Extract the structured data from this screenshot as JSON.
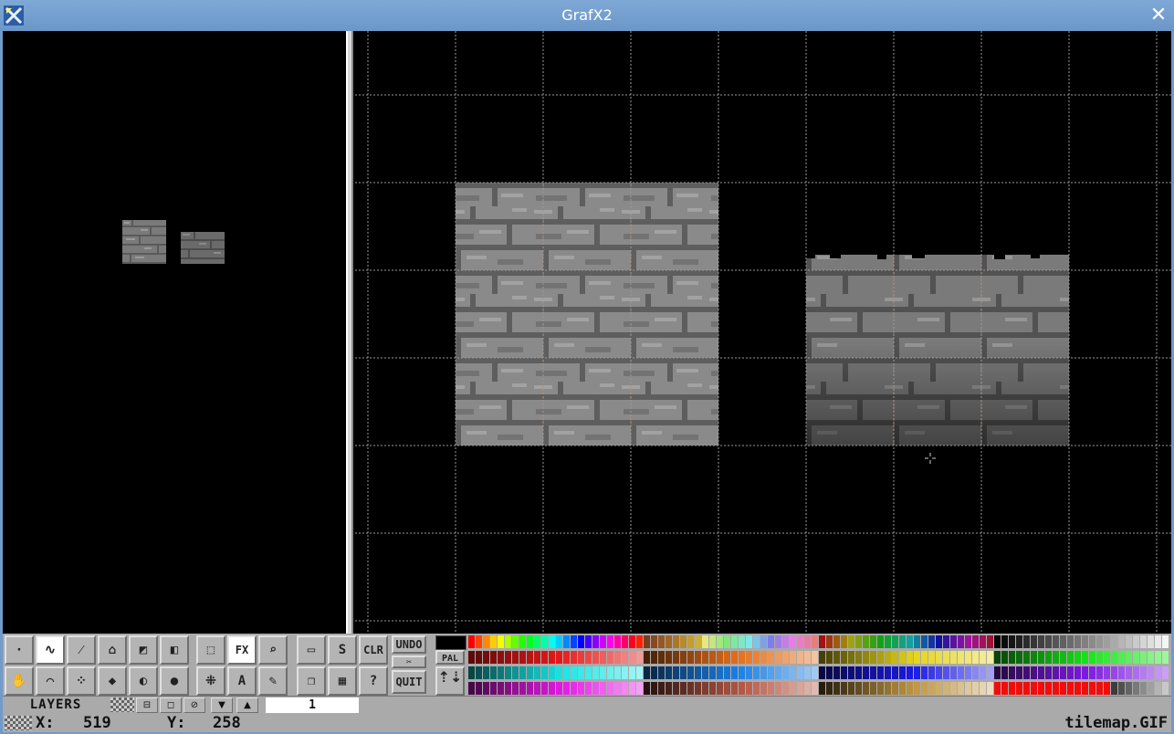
{
  "window": {
    "title": "GrafX2",
    "close_icon": "✕"
  },
  "preview": {
    "thumbnails": [
      "tile-stone-square",
      "tile-stone-top"
    ]
  },
  "toolbar": {
    "tools_row1": [
      {
        "name": "dot-brush-tool",
        "glyph": "·"
      },
      {
        "name": "freehand-tool",
        "glyph": "∿",
        "selected": true
      },
      {
        "name": "line-tool",
        "glyph": "⁄"
      },
      {
        "name": "fill-tool",
        "glyph": "⌂"
      },
      {
        "name": "gradient-rect-tool",
        "glyph": "◩"
      },
      {
        "name": "rect-tool",
        "glyph": "◧"
      }
    ],
    "tools_row2": [
      {
        "name": "pan-tool",
        "glyph": "✋"
      },
      {
        "name": "curve-tool",
        "glyph": "⌒"
      },
      {
        "name": "spray-tool",
        "glyph": "⁘"
      },
      {
        "name": "polyfill-tool",
        "glyph": "◆"
      },
      {
        "name": "ellipse-tool",
        "glyph": "◐"
      },
      {
        "name": "sphere-tool",
        "glyph": "●"
      }
    ],
    "group2_row1": [
      {
        "name": "brush-select-tool",
        "glyph": "⬚"
      },
      {
        "name": "effects-button",
        "glyph": "FX",
        "selected": true
      },
      {
        "name": "magnifier-tool",
        "glyph": "⌕"
      }
    ],
    "group2_row2": [
      {
        "name": "grab-brush-tool",
        "glyph": "⁜"
      },
      {
        "name": "text-tool",
        "glyph": "A"
      },
      {
        "name": "eyedropper-tool",
        "glyph": "✎"
      }
    ],
    "group3_row1": [
      {
        "name": "screen-settings-button",
        "glyph": "▭"
      },
      {
        "name": "save-load-button",
        "glyph": "S"
      },
      {
        "name": "clear-button",
        "glyph": "CLR"
      }
    ],
    "group3_row2": [
      {
        "name": "page-swap-button",
        "glyph": "❐"
      },
      {
        "name": "settings-button",
        "glyph": "▦"
      },
      {
        "name": "help-button",
        "glyph": "?"
      }
    ],
    "undo_label": "UNDO",
    "kill_label": "✂",
    "quit_label": "QUIT",
    "pal_label": "PAL",
    "scroll_glyph": "⇡⇣"
  },
  "layers": {
    "label": "LAYERS",
    "buttons": [
      "⊟",
      "◻",
      "⊘",
      "▼",
      "▲"
    ],
    "current_layer": "1"
  },
  "status": {
    "x_label": "X:",
    "x_value": "519",
    "y_label": "Y:",
    "y_value": "258",
    "filename": "tilemap.GIF"
  },
  "colors": {
    "toolbar_bg": "#aaaaaa",
    "titlebar": "#6f9bcb",
    "grid": "#8a8a8a",
    "stone_light": "#8e8e8e",
    "stone_dark": "#585858"
  }
}
